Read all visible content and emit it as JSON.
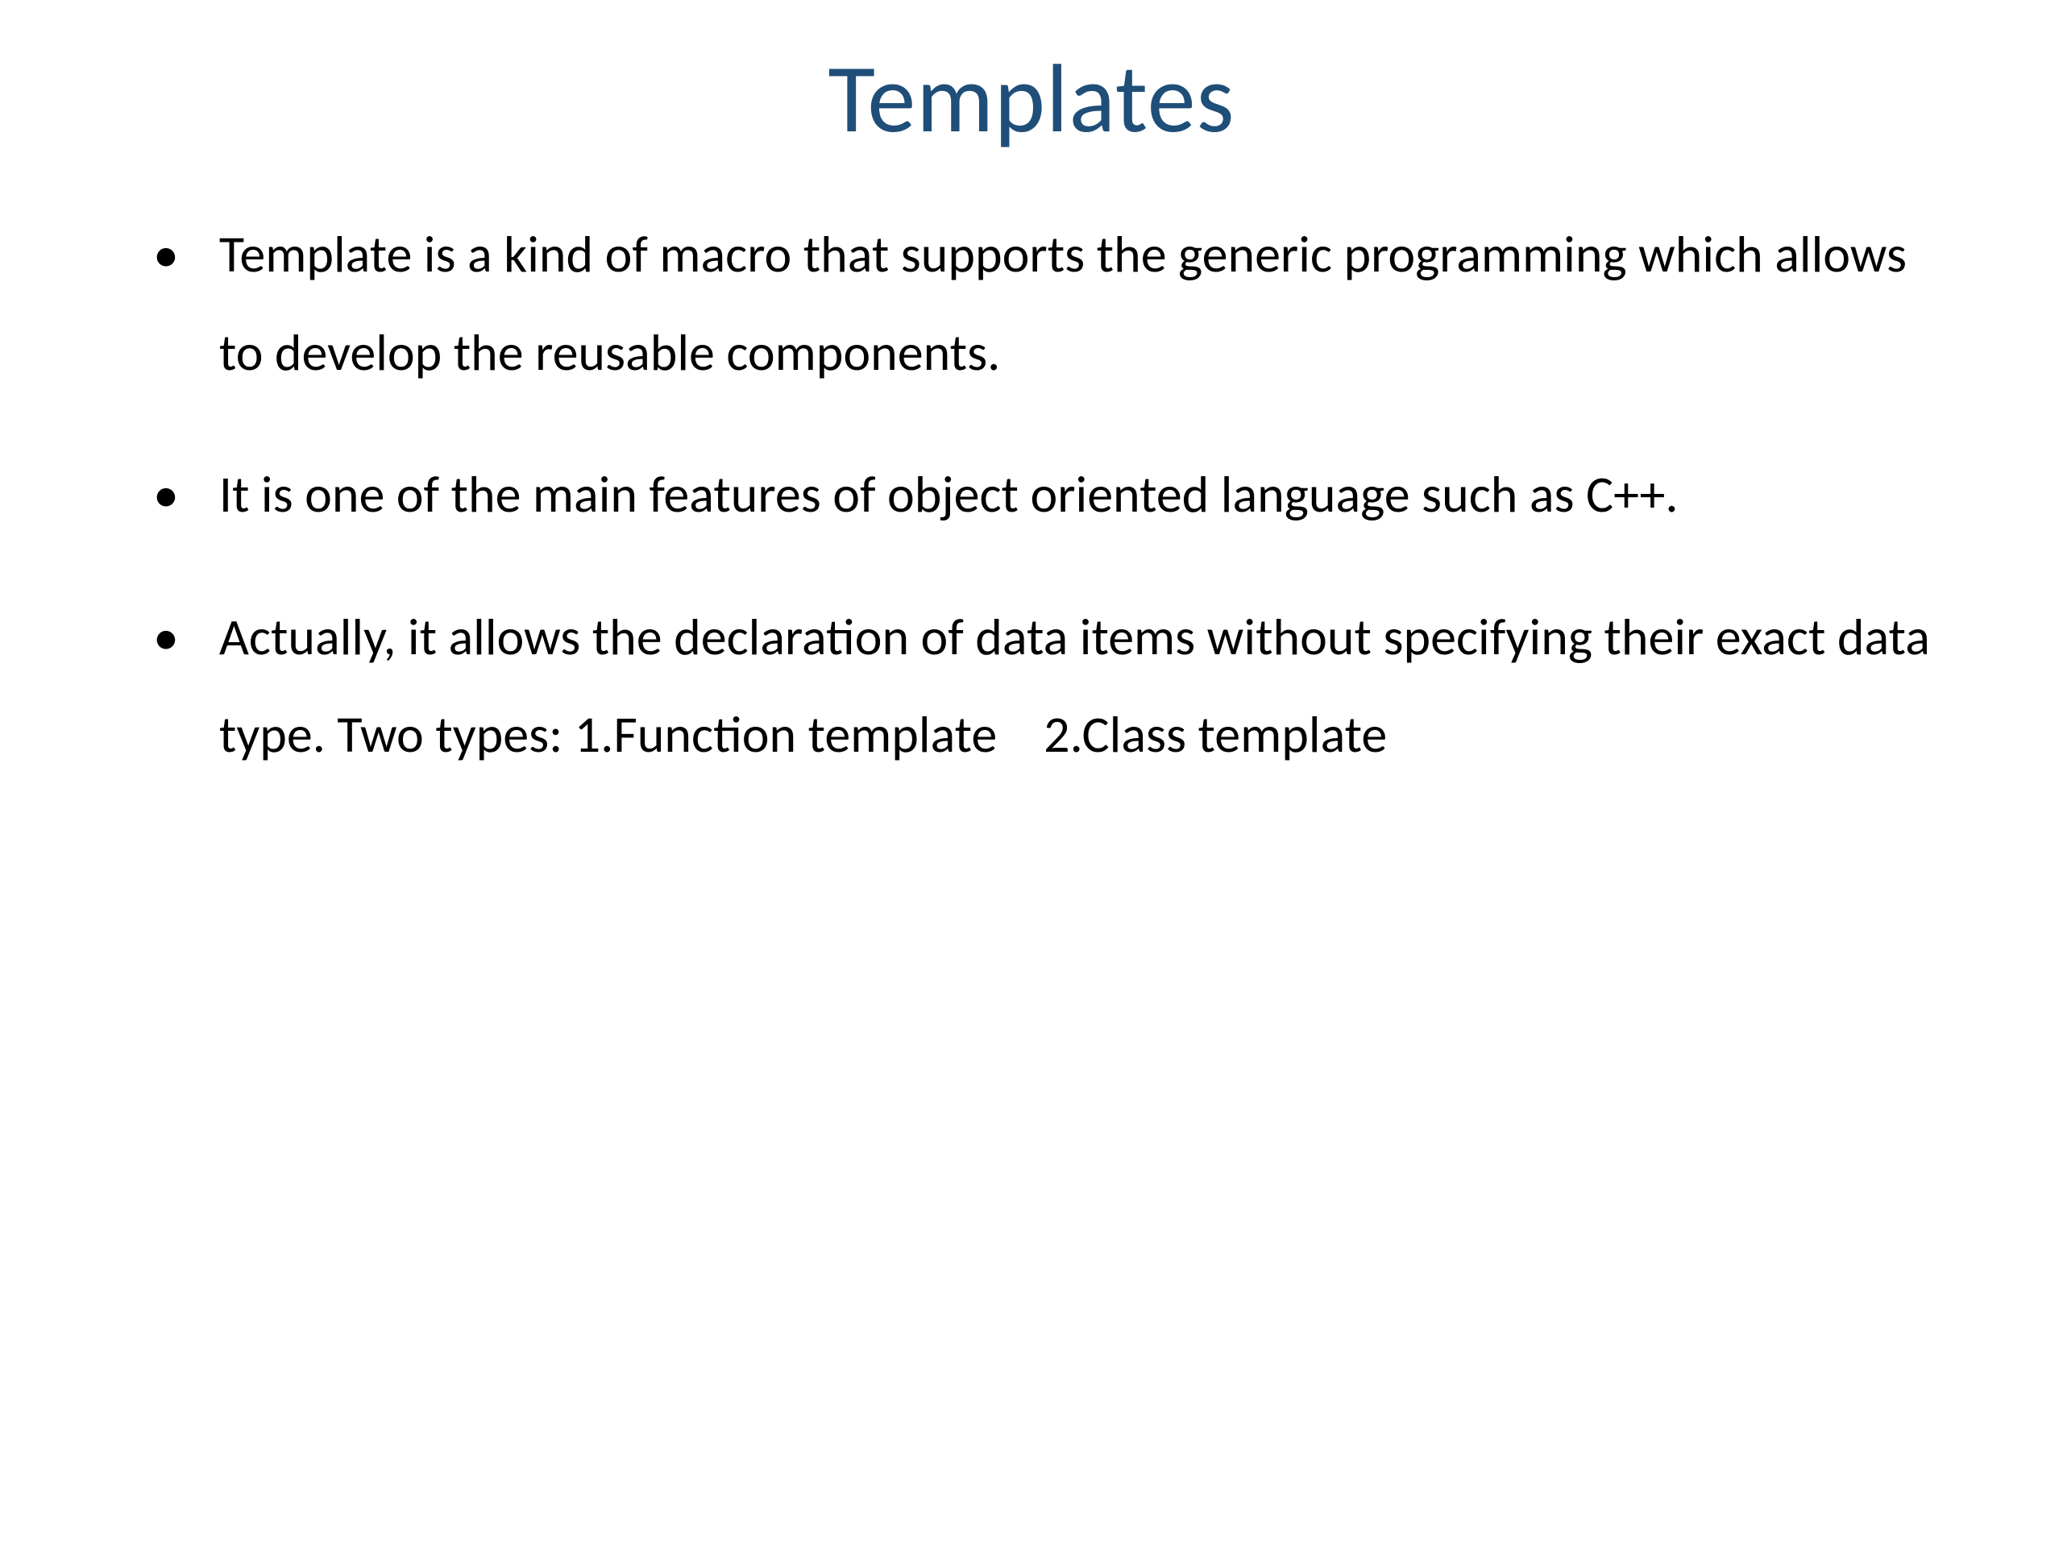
{
  "slide": {
    "title": "Templates",
    "bullets": [
      "Template is a kind of macro that supports the generic programming which allows to develop the reusable components.",
      "It is one of the main features of object oriented language such as C++.",
      "Actually, it allows the declaration of data items without specifying their exact data type. Two types: 1.Function template    2.Class template"
    ]
  }
}
